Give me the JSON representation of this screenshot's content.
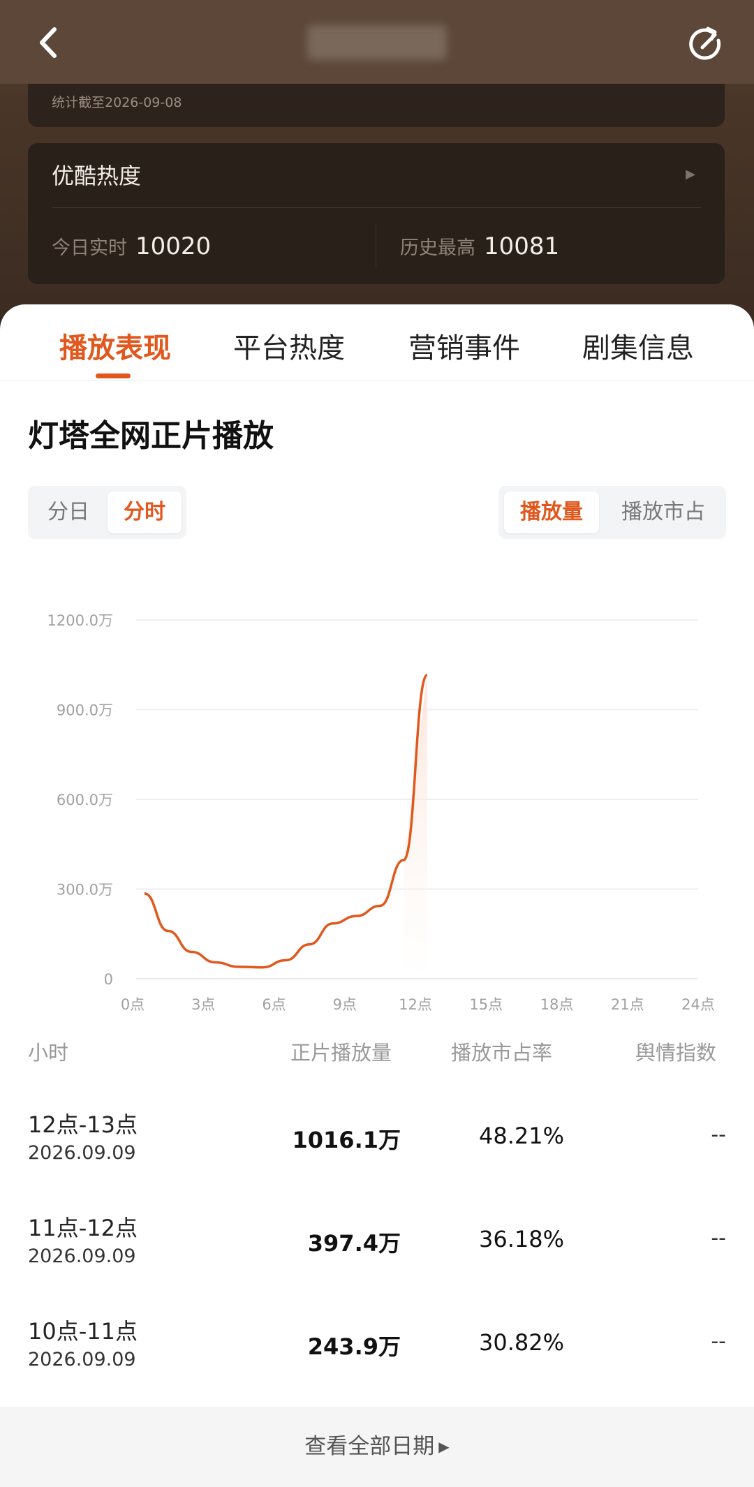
{
  "stat": {
    "date_text": "统计截至2026-09-08"
  },
  "heat": {
    "title": "优酷热度",
    "today_label": "今日实时",
    "today_value": "10020",
    "history_label": "历史最高",
    "history_value": "10081"
  },
  "tabs": [
    {
      "label": "播放表现",
      "active": true
    },
    {
      "label": "平台热度",
      "active": false
    },
    {
      "label": "营销事件",
      "active": false
    },
    {
      "label": "剧集信息",
      "active": false
    }
  ],
  "section_title": "灯塔全网正片播放",
  "period_toggle": {
    "day": "分日",
    "hour": "分时",
    "selected": "分时"
  },
  "metric_toggle": {
    "plays": "播放量",
    "share": "播放市占",
    "selected": "播放量"
  },
  "chart_data": {
    "type": "line",
    "x_ticks": [
      "0点",
      "3点",
      "6点",
      "9点",
      "12点",
      "15点",
      "18点",
      "21点",
      "24点"
    ],
    "y_ticks": [
      "0",
      "300.0万",
      "600.0万",
      "900.0万",
      "1200.0万"
    ],
    "ylim": [
      0,
      1200
    ],
    "xlim": [
      0,
      24
    ],
    "grid": true,
    "color": "#e0581e",
    "series": [
      {
        "x": [
          0.5,
          1.5,
          2.5,
          3.5,
          4.5,
          5.5,
          6.5,
          7.5,
          8.5,
          9.5,
          10.5,
          11.5,
          12.5
        ],
        "values": [
          285,
          160,
          90,
          55,
          40,
          38,
          62,
          115,
          185,
          210,
          244,
          397,
          1016
        ]
      }
    ]
  },
  "table": {
    "headers": [
      "小时",
      "正片播放量",
      "播放市占率",
      "舆情指数"
    ],
    "rows": [
      {
        "hour": "12点-13点",
        "date": "2026.09.09",
        "plays": "1016.1万",
        "share": "48.21%",
        "senti": "--"
      },
      {
        "hour": "11点-12点",
        "date": "2026.09.09",
        "plays": "397.4万",
        "share": "36.18%",
        "senti": "--"
      },
      {
        "hour": "10点-11点",
        "date": "2026.09.09",
        "plays": "243.9万",
        "share": "30.82%",
        "senti": "--"
      }
    ]
  },
  "footer": {
    "label": "查看全部日期"
  }
}
